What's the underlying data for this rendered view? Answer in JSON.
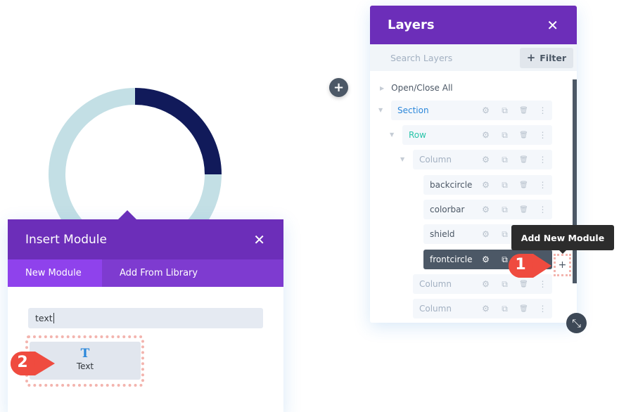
{
  "donut": {
    "progress_fraction": 0.25,
    "track_color": "#c3dfe5",
    "fill_color": "#111a5a"
  },
  "canvas": {
    "add_button_icon": "plus-icon"
  },
  "layers": {
    "title": "Layers",
    "close_icon": "close-icon",
    "search_placeholder": "Search Layers",
    "filter_label": "Filter",
    "open_close_all": "Open/Close All",
    "items": [
      {
        "label": "Section",
        "color": "#2b87da",
        "level": 0
      },
      {
        "label": "Row",
        "color": "#29c4a9",
        "level": 1
      },
      {
        "label": "Column",
        "color": "#a2b0c1",
        "level": 2
      },
      {
        "label": "backcircle",
        "color": "#4c5866",
        "level": 3
      },
      {
        "label": "colorbar",
        "color": "#4c5866",
        "level": 3
      },
      {
        "label": "shield",
        "color": "#4c5866",
        "level": 3
      },
      {
        "label": "frontcircle",
        "color": "#ffffff",
        "level": 3,
        "active": true
      },
      {
        "label": "Column",
        "color": "#a2b0c1",
        "level": 2
      },
      {
        "label": "Column",
        "color": "#a2b0c1",
        "level": 2
      }
    ],
    "tooltip": "Add New Module",
    "add_module_icon": "+"
  },
  "badges": {
    "step1": "1",
    "step2": "2",
    "color": "#ef4b3f"
  },
  "insert_module": {
    "title": "Insert Module",
    "tabs": [
      {
        "label": "New Module",
        "active": true
      },
      {
        "label": "Add From Library",
        "active": false
      }
    ],
    "search_value": "text",
    "result": {
      "icon": "T",
      "label": "Text"
    }
  },
  "colors": {
    "purple_header": "#6c2eb9",
    "purple_tabs": "#7e3bd0",
    "purple_active_tab": "#8f42ec"
  }
}
